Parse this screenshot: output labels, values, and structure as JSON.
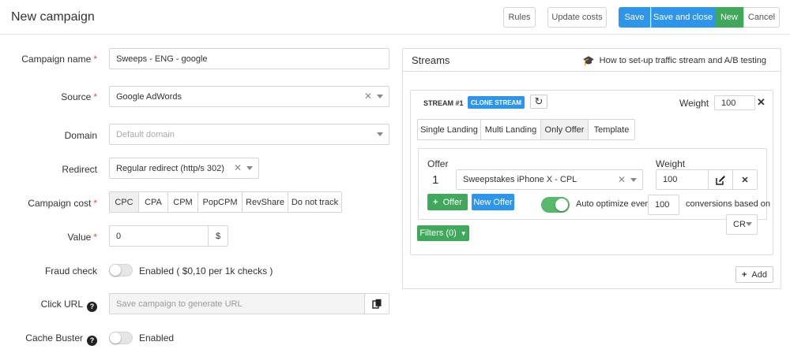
{
  "header": {
    "title": "New campaign",
    "buttons": {
      "rules": "Rules",
      "update_costs": "Update costs",
      "save": "Save",
      "save_and_close": "Save and close",
      "new": "New",
      "cancel": "Cancel"
    }
  },
  "form": {
    "campaign_name": {
      "label": "Campaign name",
      "value": "Sweeps - ENG - google"
    },
    "source": {
      "label": "Source",
      "value": "Google AdWords"
    },
    "domain": {
      "label": "Domain",
      "placeholder": "Default domain"
    },
    "redirect": {
      "label": "Redirect",
      "value": "Regular redirect (http/s 302)"
    },
    "campaign_cost": {
      "label": "Campaign cost",
      "options": [
        "CPC",
        "CPA",
        "CPM",
        "PopCPM",
        "RevShare",
        "Do not track"
      ],
      "selected": "CPC"
    },
    "value": {
      "label": "Value",
      "value": "0",
      "currency": "$"
    },
    "fraud_check": {
      "label": "Fraud check",
      "text": "Enabled ( $0,10 per 1k checks )",
      "enabled": false
    },
    "click_url": {
      "label": "Click URL",
      "placeholder": "Save campaign to generate URL"
    },
    "cache_buster": {
      "label": "Cache Buster",
      "text": "Enabled",
      "enabled": false
    },
    "required_mark": "*",
    "help_mark": "?"
  },
  "streams": {
    "title": "Streams",
    "howto_text": "How to set-up traffic stream and A/B testing",
    "stream": {
      "label": "STREAM #1",
      "clone_label": "CLONE STREAM",
      "weight_label": "Weight",
      "weight_value": "100",
      "tabs": [
        "Single Landing",
        "Multi Landing",
        "Only Offer",
        "Template"
      ],
      "active_tab": "Only Offer",
      "offer_label": "Offer",
      "offer_weight_label": "Weight",
      "offer_index": "1",
      "offer_value": "Sweepstakes iPhone X - CPL",
      "offer_weight_value": "100",
      "add_offer_label": "Offer",
      "new_offer_label": "New Offer",
      "auto_optimize_label": "Auto optimize every",
      "auto_optimize_value": "100",
      "conversions_label": "conversions based on",
      "cr_value": "CR",
      "filters_label": "Filters (0)",
      "auto_optimize_enabled": true
    },
    "add_label": "Add"
  },
  "colors": {
    "primary_blue": "#2d95ec",
    "success_green": "#3fa85a",
    "required_red": "#d9534f"
  }
}
